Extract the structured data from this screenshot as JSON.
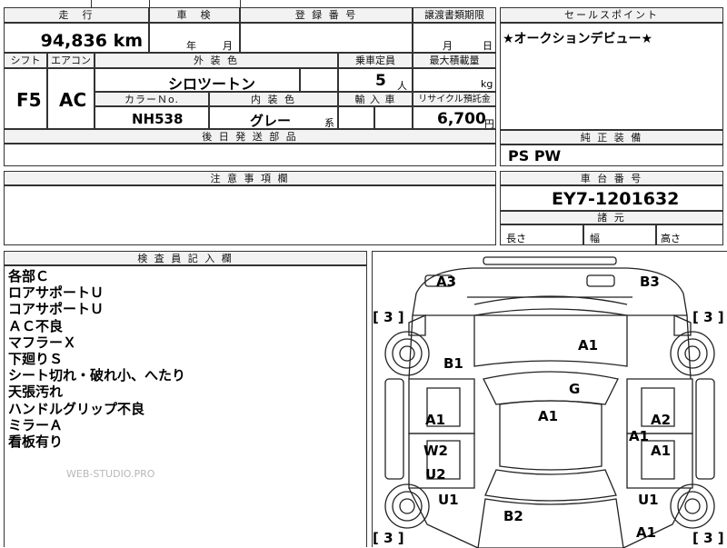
{
  "header": {
    "mileage_label": "走　行",
    "inspection_label": "車　検",
    "registration_label": "登 録 番 号",
    "transfer_deadline_label": "譲渡書類期限",
    "selling_points_label": "セールスポイント",
    "mileage_value": "94,836",
    "mileage_unit": "km",
    "year_unit": "年",
    "month_unit": "月",
    "day_unit": "日",
    "transfer_month_unit": "月"
  },
  "spec": {
    "shift_label": "シフト",
    "aircon_label": "エアコン",
    "exterior_color_label": "外 装 色",
    "capacity_label": "乗車定員",
    "max_load_label": "最大積載量",
    "shift_value": "F5",
    "aircon_value": "AC",
    "exterior_color_value": "シロツートン",
    "capacity_value": "5",
    "capacity_unit": "人",
    "load_unit": "kg",
    "color_no_label": "カラーＮo.",
    "interior_color_label": "内 装 色",
    "import_label": "輸 入 車",
    "recycle_label": "リサイクル預託金",
    "color_no_value": "NH538",
    "interior_color_value": "グレー",
    "interior_color_suffix": "系",
    "recycle_value": "6,700",
    "recycle_unit": "円"
  },
  "selling_points": {
    "text": "★オークションデビュー★"
  },
  "equipment": {
    "label": "純 正 装 備",
    "value": "PS PW"
  },
  "parts": {
    "label": "後 日 発 送 部 品"
  },
  "notes": {
    "label": "注 意 事 項 欄"
  },
  "chassis": {
    "label": "車 台 番 号",
    "value": "EY7-1201632",
    "dimensions_label": "諸 元",
    "length_label": "長さ",
    "width_label": "幅",
    "height_label": "高さ"
  },
  "remarks": {
    "label": "検 査 員 記 入 欄",
    "lines": [
      "各部Ｃ",
      "ロアサポートＵ",
      "コアサポートＵ",
      "ＡＣ不良",
      "マフラーＸ",
      "下廻りＳ",
      "シート切れ・破れ小、へたり",
      "天張汚れ",
      "ハンドルグリップ不良",
      "ミラーＡ",
      "看板有り"
    ]
  },
  "watermark": "WEB-STUDIO.PRO",
  "diagram": {
    "tire_labels": [
      "[ 3 ]",
      "[ 3 ]",
      "[ 3 ]",
      "[ 3 ]"
    ],
    "marks": {
      "front_left_corner": "A3",
      "front_right_corner": "B3",
      "hood": "A1",
      "left_fender": "B1",
      "windshield": "G",
      "left_front_door": "A1",
      "roof": "A1",
      "right_front_door_upper": "A2",
      "right_front_door_lower": "A1",
      "right_rear_door": "A1",
      "left_rear_window": "W2",
      "left_rear_door": "U2",
      "left_rear_fender": "U1",
      "right_rear_fender": "U1",
      "trunk": "B2",
      "right_rear_corner": "A1"
    }
  }
}
